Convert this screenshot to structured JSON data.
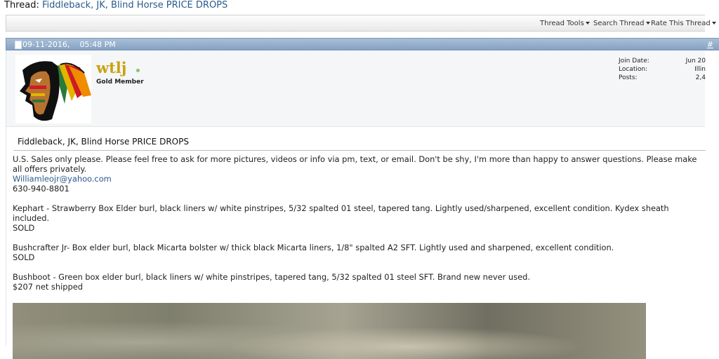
{
  "thread": {
    "label": "Thread:",
    "title": "Fiddleback, JK, Blind Horse PRICE DROPS"
  },
  "toolbar": {
    "tools": "Thread Tools",
    "search": "Search Thread",
    "rate": "Rate This Thread"
  },
  "post": {
    "date": "09-11-2016,",
    "time": "05:48 PM",
    "number": "#",
    "user": {
      "name": "wtlj",
      "title": "Gold Member",
      "join_label": "Join Date:",
      "join_value": "Jun 20",
      "location_label": "Location:",
      "location_value": "Illin",
      "posts_label": "Posts:",
      "posts_value": "2,4"
    },
    "title": "Fiddleback, JK, Blind Horse PRICE DROPS",
    "body": {
      "intro": "U.S. Sales only please. Please feel free to ask for more pictures, videos or info via pm, text, or email. Don't be shy, I'm more than happy to answer questions. Please make all offers privately.",
      "email": "Williamleojr@yahoo.com",
      "phone": "630-940-8801",
      "item1": "Kephart - Strawberry Box Elder burl, black liners w/ white pinstripes, 5/32 spalted 01 steel, tapered tang. Lightly used/sharpened, excellent condition. Kydex sheath included.",
      "item1_status": "SOLD",
      "item2": "Bushcrafter Jr- Box elder burl, black Micarta bolster w/ thick black Micarta liners, 1/8\" spalted A2 SFT. Lightly used and sharpened, excellent condition.",
      "item2_status": "SOLD",
      "item3": "Bushboot - Green box elder burl, black liners w/ white pinstripes, tapered tang, 5/32 spalted 01 steel SFT. Brand new never used.",
      "item3_price": "$207 net shipped"
    }
  },
  "icons": {
    "avatar": "blackhawks-logo",
    "online": "online-dot-icon",
    "post": "post-document-icon",
    "menu": "caret-down-icon"
  }
}
